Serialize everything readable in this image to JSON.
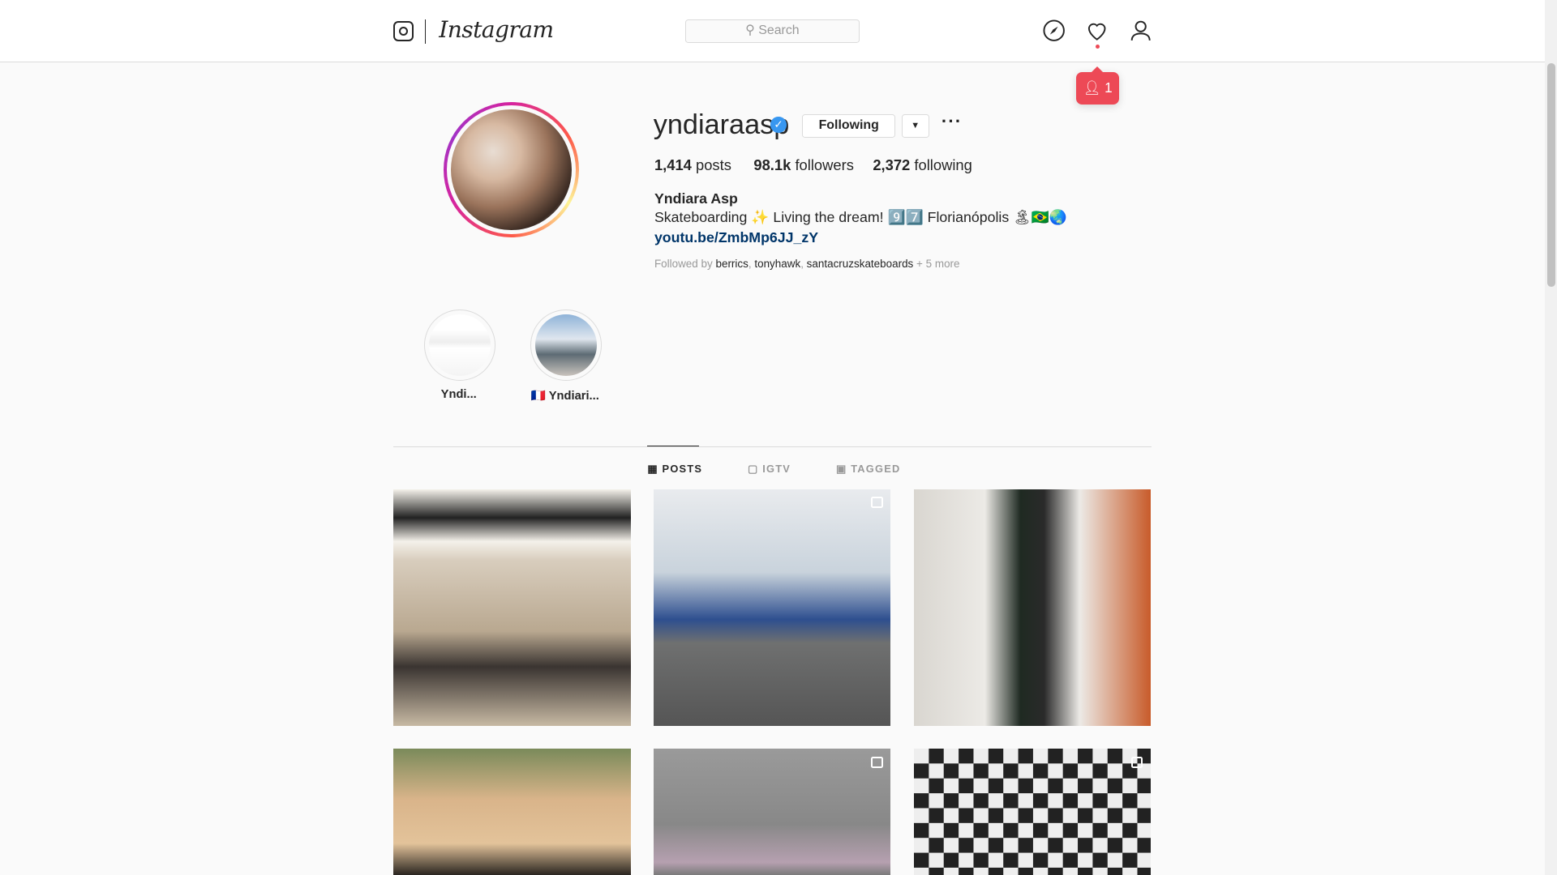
{
  "header": {
    "logo_text": "Instagram",
    "search_placeholder": "Search",
    "nav_icons": [
      "compass-icon",
      "heart-icon",
      "user-icon"
    ],
    "notification": {
      "count": "1",
      "icon": "person-icon"
    },
    "accent_color": "#ed4956"
  },
  "profile": {
    "username": "yndiaraasp",
    "verified": true,
    "following_label": "Following",
    "more_label": "···",
    "stats": [
      {
        "value": "1,414",
        "label": "posts"
      },
      {
        "value": "98.1k",
        "label": "followers"
      },
      {
        "value": "2,372",
        "label": "following"
      }
    ],
    "full_name": "Yndiara Asp",
    "bio": "Skateboarding ✨ Living the dream! 9️⃣7️⃣ Florianópolis 🏝🇧🇷🌏",
    "link": "youtu.be/ZmbMp6JJ_zY",
    "followed_by_prefix": "Followed by",
    "followed_by_users": [
      "berrics",
      "tonyhawk",
      "santacruzskateboards"
    ],
    "followed_by_more": "+ 5 more"
  },
  "highlights": [
    {
      "label": "Yndi..."
    },
    {
      "label": "🇫🇷 Yndiari..."
    }
  ],
  "tabs": [
    {
      "label": "POSTS",
      "icon": "grid-icon",
      "active": true
    },
    {
      "label": "IGTV",
      "icon": "igtv-icon",
      "active": false
    },
    {
      "label": "TAGGED",
      "icon": "tagged-icon",
      "active": false
    }
  ],
  "posts": [
    {
      "type": "image"
    },
    {
      "type": "video"
    },
    {
      "type": "image"
    },
    {
      "type": "image"
    },
    {
      "type": "carousel"
    },
    {
      "type": "carousel"
    }
  ]
}
